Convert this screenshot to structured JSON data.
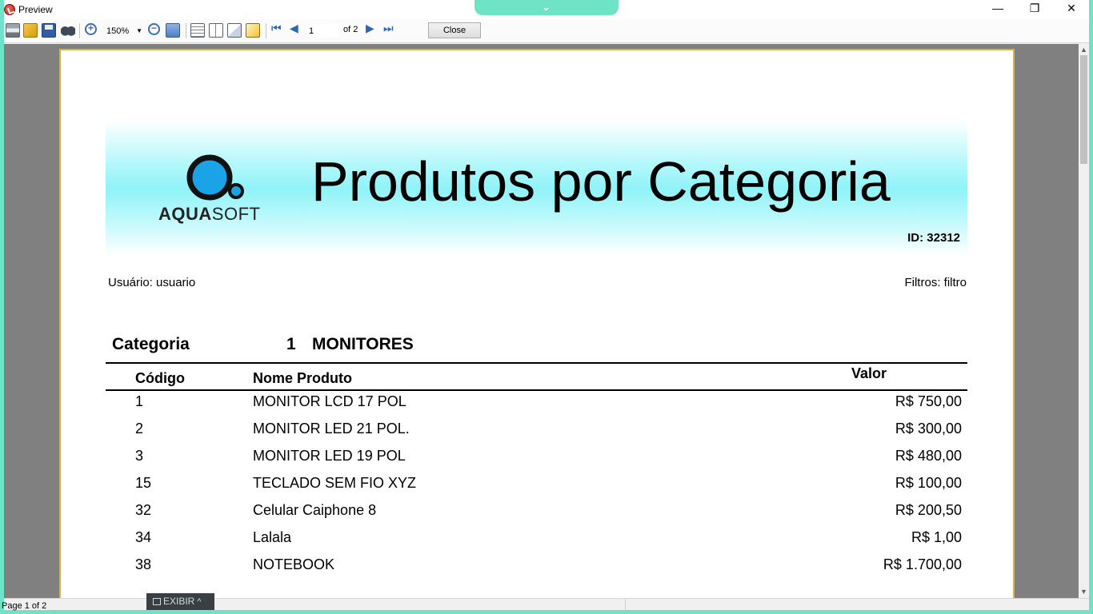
{
  "window": {
    "title": "Preview"
  },
  "toolbar": {
    "zoom_value": "150%",
    "page_current": "1",
    "page_of": "of 2",
    "close_label": "Close"
  },
  "report": {
    "logo_text_bold": "AQUA",
    "logo_text_light": "SOFT",
    "title": "Produtos por Categoria",
    "id_label": "ID: 32312",
    "user_line": "Usuário: usuario",
    "filter_line": "Filtros: filtro",
    "category": {
      "label": "Categoria",
      "number": "1",
      "name": "MONITORES"
    },
    "columns": {
      "code": "Código",
      "name": "Nome Produto",
      "value": "Valor"
    },
    "rows": [
      {
        "code": "1",
        "name": "MONITOR LCD 17 POL",
        "value": "R$ 750,00"
      },
      {
        "code": "2",
        "name": "MONITOR LED 21 POL.",
        "value": "R$ 300,00"
      },
      {
        "code": "3",
        "name": "MONITOR LED 19 POL",
        "value": "R$ 480,00"
      },
      {
        "code": "15",
        "name": "TECLADO SEM FIO XYZ",
        "value": "R$ 100,00"
      },
      {
        "code": "32",
        "name": "Celular Caiphone 8",
        "value": "R$ 200,50"
      },
      {
        "code": "34",
        "name": "Lalala",
        "value": "R$ 1,00"
      },
      {
        "code": "38",
        "name": "NOTEBOOK",
        "value": "R$ 1.700,00"
      }
    ]
  },
  "statusbar": {
    "page_text": "Page 1 of 2"
  },
  "taskbar": {
    "exibir_label": "EXIBIR"
  },
  "icons": {
    "app": "crystal-reports-icon",
    "print": "print-icon",
    "open": "folder-open-icon",
    "save": "save-icon",
    "find": "binoculars-icon",
    "zoom_in": "zoom-in-icon",
    "zoom_out": "zoom-out-icon",
    "fit": "fit-page-icon"
  }
}
